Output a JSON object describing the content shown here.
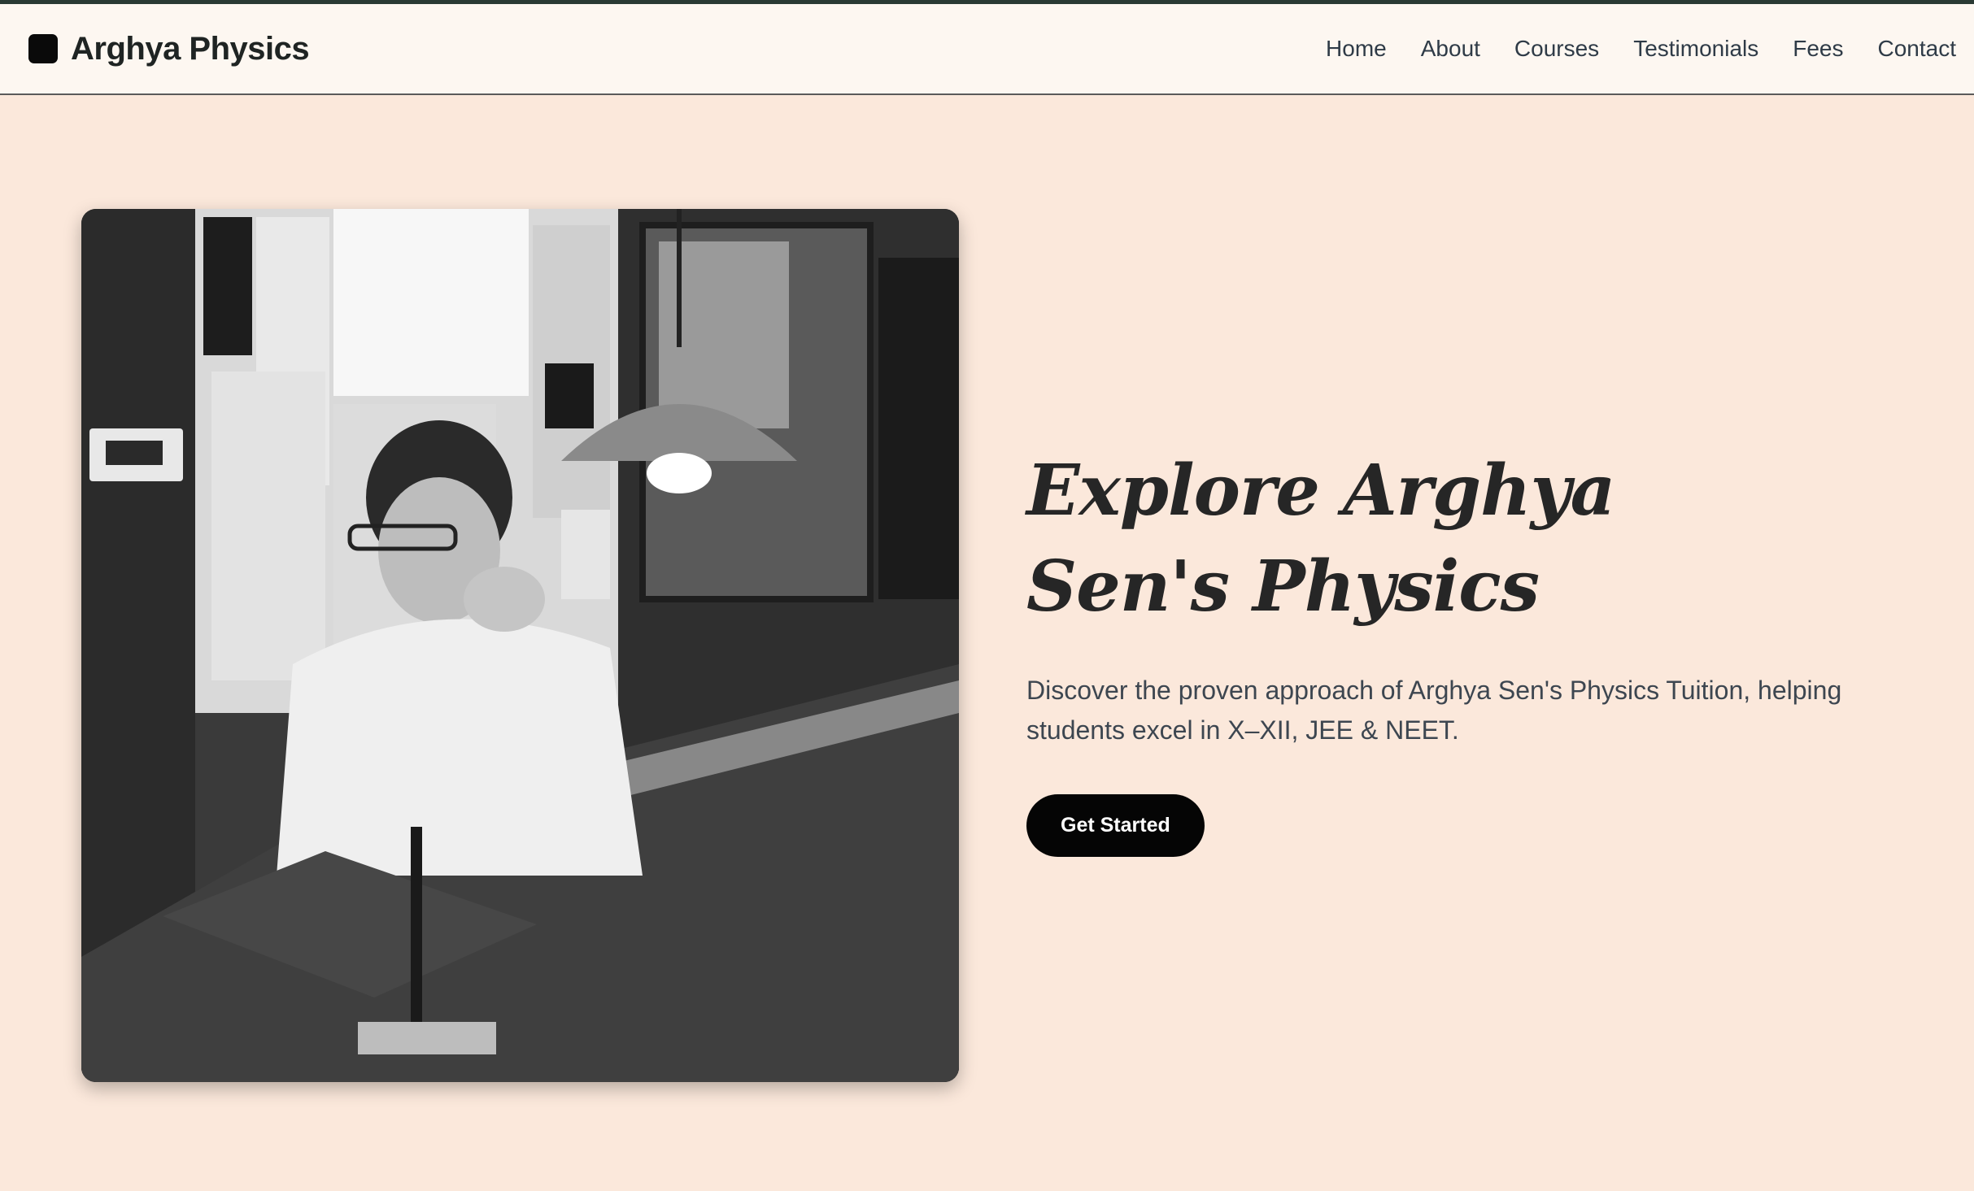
{
  "header": {
    "brand": "Arghya Physics",
    "nav": [
      {
        "label": "Home"
      },
      {
        "label": "About"
      },
      {
        "label": "Courses"
      },
      {
        "label": "Testimonials"
      },
      {
        "label": "Fees"
      },
      {
        "label": "Contact"
      }
    ]
  },
  "hero": {
    "title_line1": "Explore Arghya",
    "title_line2": "Sen's Physics",
    "description": "Discover the proven approach of Arghya Sen's Physics Tuition, helping students excel in X–XII, JEE & NEET.",
    "cta_label": "Get Started",
    "photo_icon": "teacher-photo"
  },
  "colors": {
    "background": "#fbe8db",
    "header_bg": "#fdf7f1",
    "cta_bg": "#050505",
    "text_dark": "#262626"
  }
}
